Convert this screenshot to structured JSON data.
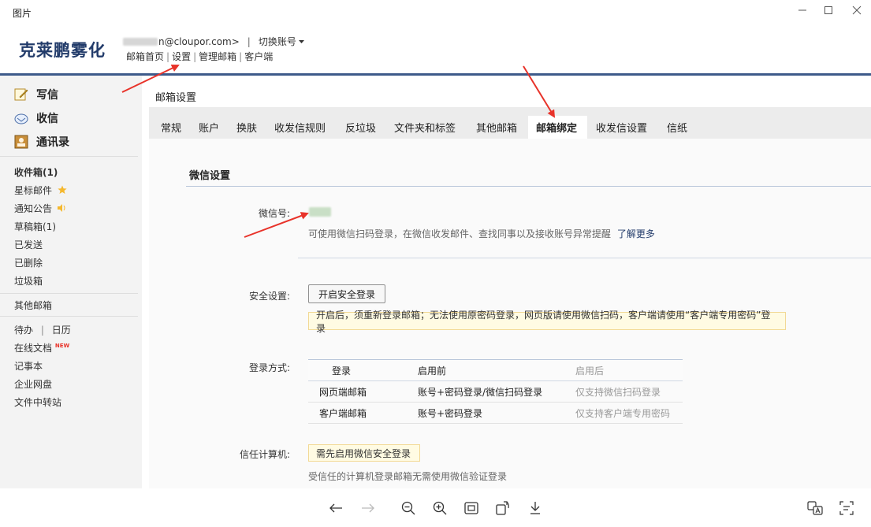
{
  "window": {
    "title": "图片",
    "icons": {
      "minimize": "minimize-icon",
      "maximize": "maximize-icon",
      "close": "close-icon"
    }
  },
  "header": {
    "brand": "克莱鹏雾化",
    "email_prefix_visible": "n@cloupor.com>",
    "sep": "|",
    "switch_account": "切换账号",
    "links": [
      "邮箱首页",
      "设置",
      "管理邮箱",
      "客户端"
    ]
  },
  "sidebar": {
    "primary": [
      {
        "label": "写信",
        "icon": "compose-icon"
      },
      {
        "label": "收信",
        "icon": "inbox-icon"
      },
      {
        "label": "通讯录",
        "icon": "contacts-icon"
      }
    ],
    "folders": [
      "收件箱(1)",
      "星标邮件",
      "通知公告",
      "草稿箱(1)",
      "已发送",
      "已删除",
      "垃圾箱"
    ],
    "other_mail": "其他邮箱",
    "todo": "待办",
    "calendar": "日历",
    "online_docs": "在线文档",
    "new_badge": "NEW",
    "tools": [
      "记事本",
      "企业网盘",
      "文件中转站"
    ]
  },
  "main": {
    "title": "邮箱设置",
    "tabs": [
      "常规",
      "账户",
      "换肤",
      "收发信规则",
      "反垃圾",
      "文件夹和标签",
      "其他邮箱",
      "邮箱绑定",
      "收发信设置",
      "信纸"
    ],
    "active_tab": "邮箱绑定",
    "wechat": {
      "section_title": "微信设置",
      "id_label": "微信号:",
      "hint": "可使用微信扫码登录，在微信收发邮件、查找同事以及接收账号异常提醒",
      "learn_more": "了解更多"
    },
    "security": {
      "label": "安全设置:",
      "button": "开启安全登录",
      "notice": "开启后，须重新登录邮箱；无法使用原密码登录，网页版请使用微信扫码，客户端请使用“客户端专用密码”登录"
    },
    "login_methods": {
      "label": "登录方式:",
      "headers": [
        "登录",
        "启用前",
        "启用后"
      ],
      "rows": [
        [
          "网页端邮箱",
          "账号+密码登录/微信扫码登录",
          "仅支持微信扫码登录"
        ],
        [
          "客户端邮箱",
          "账号+密码登录",
          "仅支持客户端专用密码"
        ]
      ]
    },
    "trusted": {
      "label": "信任计算机:",
      "notice": "需先启用微信安全登录",
      "hint": "受信任的计算机登录邮箱无需使用微信验证登录"
    }
  },
  "viewer_toolbar": {
    "icons": [
      "back-arrow-icon",
      "forward-arrow-icon",
      "zoom-out-icon",
      "zoom-in-icon",
      "fit-screen-icon",
      "rotate-icon",
      "download-icon",
      "translate-icon",
      "text-recognition-icon"
    ]
  },
  "colors": {
    "accent": "#3d5a8a",
    "brand": "#223b6a",
    "annotation": "#e8332a",
    "notice_bg": "#fffbe3"
  }
}
